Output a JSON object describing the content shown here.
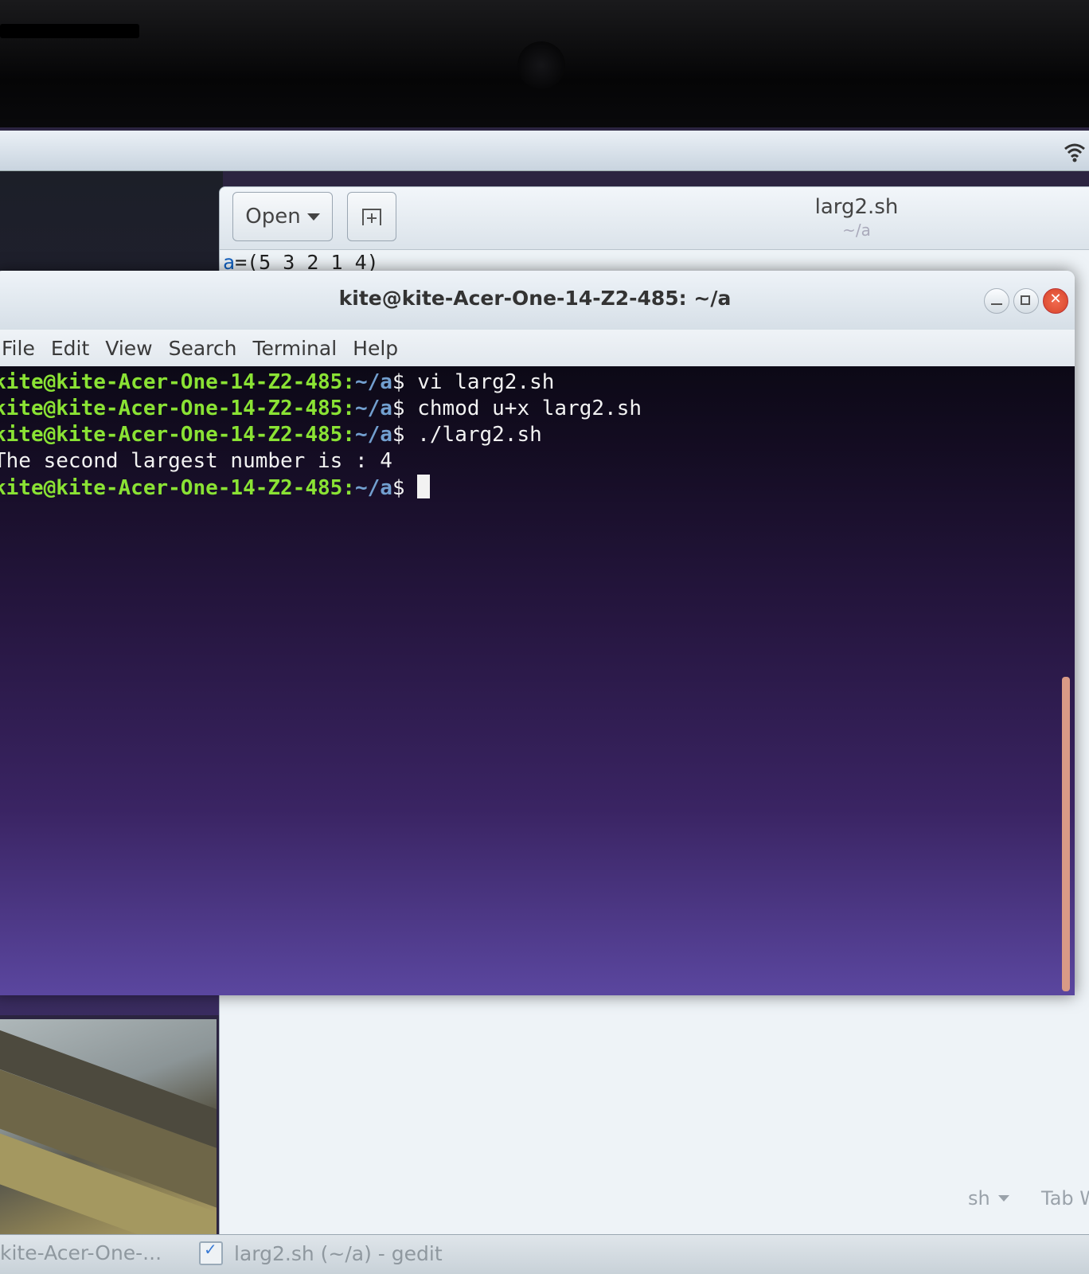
{
  "gedit": {
    "open_label": "Open",
    "title": "larg2.sh",
    "subtitle": "~/a",
    "code_line_var": "a",
    "code_line_rest": "=(5 3 2 1 4)",
    "status_language": "sh",
    "status_tab": "Tab W"
  },
  "terminal": {
    "title": "kite@kite-Acer-One-14-Z2-485: ~/a",
    "menu": [
      "File",
      "Edit",
      "View",
      "Search",
      "Terminal",
      "Help"
    ],
    "prompt_user": "kite@kite-Acer-One-14-Z2-485:",
    "prompt_path": "~/a",
    "prompt_symbol": "$ ",
    "commands": [
      "vi larg2.sh",
      "chmod u+x larg2.sh",
      "./larg2.sh"
    ],
    "output": "The second largest number is : 4"
  },
  "taskbar": {
    "terminal_item": "kite-Acer-One-...",
    "gedit_item": "larg2.sh (~/a) - gedit"
  },
  "colors": {
    "prompt_user": "#8ae234",
    "prompt_path": "#729fcf",
    "terminal_bg_top": "#0c0916",
    "terminal_bg_bottom": "#5b47a0"
  },
  "icons": [
    "wifi-icon",
    "new-tab-icon",
    "minimize-icon",
    "maximize-icon",
    "close-icon",
    "gedit-app-icon"
  ]
}
